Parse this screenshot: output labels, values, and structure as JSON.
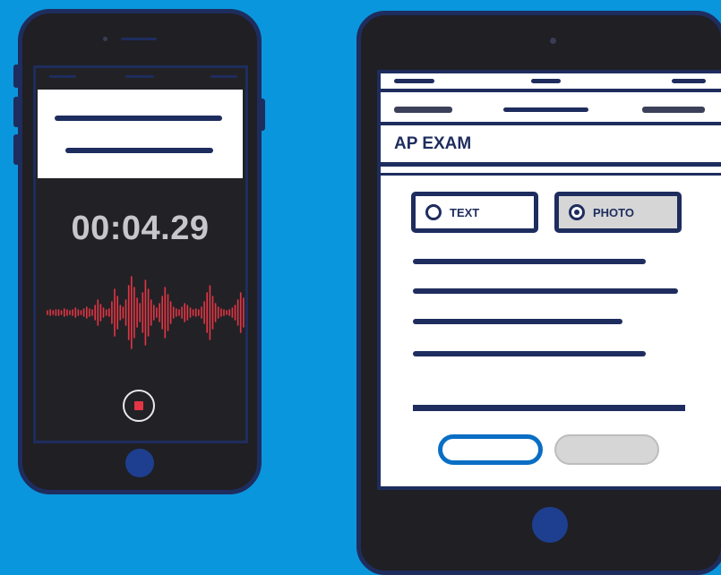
{
  "phone": {
    "timer": "00:04.29",
    "waveform_color": "#e43544",
    "stop_icon": "stop-record-icon"
  },
  "tablet": {
    "exam_title": "AP EXAM",
    "options": [
      {
        "label": "TEXT",
        "selected": false
      },
      {
        "label": "PHOTO",
        "selected": true
      }
    ]
  },
  "colors": {
    "background": "#0a96dc",
    "navy": "#1e2d5e",
    "device": "#1f1f24",
    "accent_blue": "#0a6ec4"
  }
}
